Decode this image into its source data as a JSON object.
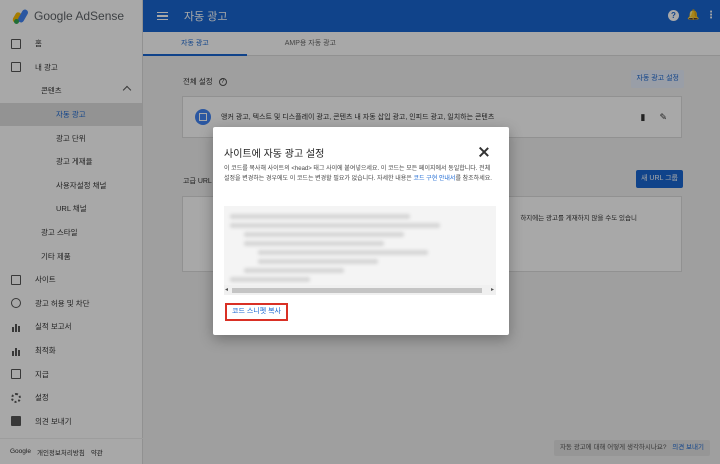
{
  "app": {
    "logo_text": "Google AdSense"
  },
  "sidebar": {
    "items": [
      {
        "label": "홈",
        "level": 0,
        "icon": "home-icon"
      },
      {
        "label": "내 광고",
        "level": 0,
        "icon": "ads-icon"
      },
      {
        "label": "콘텐츠",
        "level": 1,
        "expanded": true
      },
      {
        "label": "자동 광고",
        "level": 2,
        "active": true
      },
      {
        "label": "광고 단위",
        "level": 2
      },
      {
        "label": "광고 게재율",
        "level": 2
      },
      {
        "label": "사용자설정 채널",
        "level": 2
      },
      {
        "label": "URL 채널",
        "level": 2
      },
      {
        "label": "광고 스타일",
        "level": 1
      },
      {
        "label": "기타 제품",
        "level": 1
      },
      {
        "label": "사이트",
        "level": 0,
        "icon": "sites-icon"
      },
      {
        "label": "광고 허용 및 차단",
        "level": 0,
        "icon": "block-icon"
      },
      {
        "label": "실적 보고서",
        "level": 0,
        "icon": "report-icon"
      },
      {
        "label": "최적화",
        "level": 0,
        "icon": "optimize-icon"
      },
      {
        "label": "지급",
        "level": 0,
        "icon": "payment-icon"
      },
      {
        "label": "설정",
        "level": 0,
        "icon": "settings-icon"
      },
      {
        "label": "의견 보내기",
        "level": 0,
        "icon": "feedback-icon"
      }
    ],
    "footer": {
      "google": "Google",
      "privacy": "개인정보처리방침",
      "terms": "약관"
    }
  },
  "topbar": {
    "title": "자동 광고",
    "help_glyph": "?",
    "bell_glyph": "🔔",
    "more_glyph": "⋮"
  },
  "tabs": [
    {
      "label": "자동 광고",
      "active": true
    },
    {
      "label": "AMP용 자동 광고",
      "active": false
    }
  ],
  "main": {
    "global_settings_label": "전체 설정",
    "auto_ads_settings_button": "자동 광고 설정",
    "card_text": "앵커 광고, 텍스트 및 디스플레이 광고, 콘텐츠 내 자동 삽입 광고, 인피드 광고, 일치하는 콘텐츠",
    "advanced_url_label": "고급 URL",
    "new_url_group_button": "새 URL 그룹",
    "panel_text": "하지에는 광고를 게재하지 않을 수도 있습니",
    "feedback_text": "자동 광고에 대해 어떻게 생각하시나요?",
    "feedback_link": "의견 보내기"
  },
  "modal": {
    "title": "사이트에 자동 광고 설정",
    "desc_main": "이 코드를 복사해 사이트의 <head> 태그 사이에 붙여넣으세요. 이 코드는 모든 페이지에서 동일합니다. 전체 설정을 변경하는 경우에도 이 코드는 변경할 필요가 없습니다. 자세한 내용은 ",
    "desc_link": "코드 구현 안내서",
    "desc_end": "를 참조하세요.",
    "copy_button": "코드 스니펫 복사",
    "scroll_left": "◂",
    "scroll_right": "▸"
  }
}
